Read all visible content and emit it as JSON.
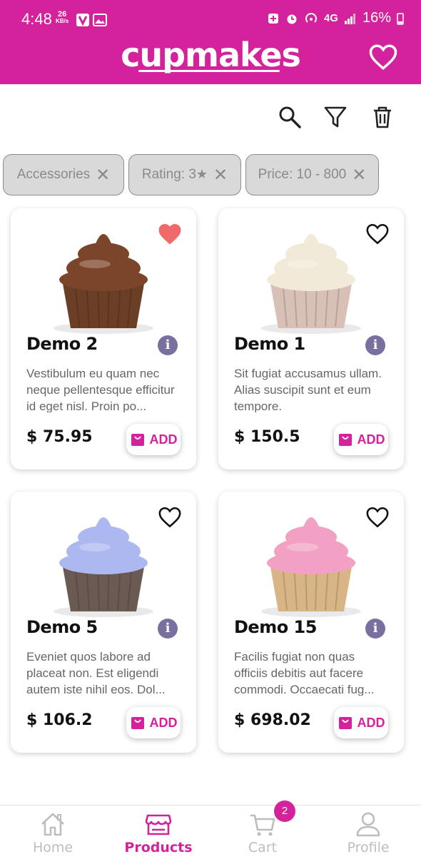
{
  "status_bar": {
    "time": "4:48",
    "net_speed_value": "26",
    "net_speed_unit": "KB/s",
    "network": "4G",
    "battery": "16%"
  },
  "header": {
    "brand": "cupmakes"
  },
  "filters": [
    {
      "label": "Accessories"
    },
    {
      "label": "Rating: 3"
    },
    {
      "label": "Price: 10 - 800"
    }
  ],
  "products": [
    {
      "name": "Demo 2",
      "description": " Vestibulum eu quam nec neque pellentesque efficitur id eget nisl. Proin po...",
      "price": "$ 75.95",
      "favorite": true,
      "frosting": "#7a4528",
      "liner": "#6b3e26"
    },
    {
      "name": "Demo 1",
      "description": " Sit fugiat accusamus ullam. Alias suscipit sunt et eum tempore.",
      "price": "$ 150.5",
      "favorite": false,
      "frosting": "#f2ead9",
      "liner": "#d8c0b6"
    },
    {
      "name": "Demo 5",
      "description": " Eveniet quos labore ad placeat non. Est eligendi autem iste nihil eos. Dol...",
      "price": "$ 106.2",
      "favorite": false,
      "frosting": "#aeb8f0",
      "liner": "#6b5a54"
    },
    {
      "name": "Demo 15",
      "description": " Facilis fugiat non quas officiis debitis aut facere commodi. Occaecati fug...",
      "price": "$ 698.02",
      "favorite": false,
      "frosting": "#f2a0c4",
      "liner": "#d9b585"
    }
  ],
  "add_label": "ADD",
  "bottom_nav": {
    "items": [
      {
        "label": "Home"
      },
      {
        "label": "Products"
      },
      {
        "label": "Cart"
      },
      {
        "label": "Profile"
      }
    ],
    "cart_badge": "2"
  },
  "colors": {
    "accent": "#d4219c",
    "info": "#7b6f9f",
    "favorite": "#f06a6a"
  }
}
